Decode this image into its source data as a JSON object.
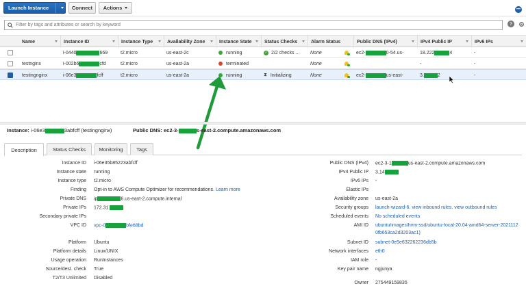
{
  "toolbar": {
    "launch_label": "Launch Instance",
    "connect_label": "Connect",
    "actions_label": "Actions"
  },
  "filter": {
    "placeholder": "Filter by tags and attributes or search by keyword"
  },
  "table": {
    "columns": [
      "Name",
      "Instance ID",
      "Instance Type",
      "Availability Zone",
      "Instance State",
      "Status Checks",
      "Alarm Status",
      "Public DNS (IPv4)",
      "IPv4 Public IP",
      "IPv6 IPs"
    ],
    "rows": [
      {
        "name": "",
        "id_prefix": "i-0440",
        "id_suffix": "669",
        "type": "t2.micro",
        "zone": "us-east-2c",
        "state": "running",
        "state_color": "#3aa63a",
        "checks": "2/2 checks ...",
        "checks_icon": "check-circle-icon",
        "alarm": "None",
        "dns_prefix": "ec2-",
        "dns_suffix": "0-54.us-",
        "ip_prefix": "18.222",
        "ip_suffix": "4",
        "ipv6": "-",
        "selected": false
      },
      {
        "name": "testnginx",
        "id_prefix": "i-002b6",
        "id_suffix": "cfd",
        "type": "t2.micro",
        "zone": "us-east-2a",
        "state": "terminated",
        "state_color": "#d9432b",
        "checks": "",
        "checks_icon": "",
        "alarm": "None",
        "dns_prefix": "",
        "dns_suffix": "",
        "ip_prefix": "-",
        "ip_suffix": "",
        "ipv6": "-",
        "selected": false
      },
      {
        "name": "testingnginx",
        "id_prefix": "i-06e3",
        "id_suffix": "fcff",
        "type": "t2.micro",
        "zone": "us-east-2a",
        "state": "running",
        "state_color": "#3aa63a",
        "checks": "Initializing",
        "checks_icon": "hourglass-icon",
        "alarm": "None",
        "dns_prefix": "ec2-",
        "dns_suffix": "us-east-",
        "ip_prefix": "3.",
        "ip_suffix": "2",
        "ipv6": "-",
        "selected": true
      }
    ]
  },
  "detail": {
    "instance_label": "Instance:",
    "instance_prefix": "i-06e3",
    "instance_suffix": "3abfcff (testingnginx)",
    "dns_label": "Public DNS:",
    "dns_prefix": "ec2-3-",
    "dns_suffix": "s-east-2.compute.amazonaws.com",
    "tabs": [
      "Description",
      "Status Checks",
      "Monitoring",
      "Tags"
    ],
    "left_fields": [
      {
        "label": "Instance ID",
        "value": "i-06e35b85223abfcff"
      },
      {
        "label": "Instance state",
        "value": "running"
      },
      {
        "label": "Instance type",
        "value": "t2.micro"
      },
      {
        "label": "Finding",
        "value": "Opt-in to AWS Compute Optimizer for recommendations.",
        "link": "Learn more"
      },
      {
        "label": "Private DNS",
        "value_prefix": "ip",
        "value_suffix": "6.us-east-2.compute.internal"
      },
      {
        "label": "Private IPs",
        "value_prefix": "172.31"
      },
      {
        "label": "Secondary private IPs",
        "value": ""
      },
      {
        "label": "VPC ID",
        "value_prefix": "vpc-0",
        "value_suffix": "bfe68bd"
      },
      {
        "label": "Platform",
        "value": "Ubuntu"
      },
      {
        "label": "Platform details",
        "value": "Linux/UNIX"
      },
      {
        "label": "Usage operation",
        "value": "RunInstances"
      },
      {
        "label": "Source/dest. check",
        "value": "True"
      },
      {
        "label": "T2/T3 Unlimited",
        "value": "Disabled"
      }
    ],
    "right_fields": [
      {
        "label": "Public DNS (IPv4)",
        "value_prefix": "ec2-3-1",
        "value_suffix": "us-east-2.compute.amazonaws.com"
      },
      {
        "label": "IPv4 Public IP",
        "value_prefix": "3.14"
      },
      {
        "label": "IPv6 IPs",
        "value": "-"
      },
      {
        "label": "Elastic IPs",
        "value": ""
      },
      {
        "label": "Availability zone",
        "value": "us-east-2a"
      },
      {
        "label": "Security groups",
        "value": "launch-wizard-6.",
        "link1": "view inbound rules",
        "link2": "view outbound rules"
      },
      {
        "label": "Scheduled events",
        "value": "No scheduled events"
      },
      {
        "label": "AMI ID",
        "value": "ubuntu/images/hvm-ssd/ubuntu-focal-20.04-amd64-server-2021112",
        "value2": "0fb653ca2d3203ac1)"
      },
      {
        "label": "Subnet ID",
        "value": "subnet-0e5e632262236db5b"
      },
      {
        "label": "Network interfaces",
        "value": "eth0"
      },
      {
        "label": "IAM role",
        "value": "-"
      },
      {
        "label": "Key pair name",
        "value": "ngjunya"
      },
      {
        "label": "Owner",
        "value": "275449159835"
      }
    ]
  },
  "colors": {
    "brand_blue": "#1f5da8",
    "redaction_green": "#18a23d",
    "arrow_green": "#1f9b3a",
    "running_green": "#3aa63a",
    "terminated_red": "#d9432b"
  }
}
